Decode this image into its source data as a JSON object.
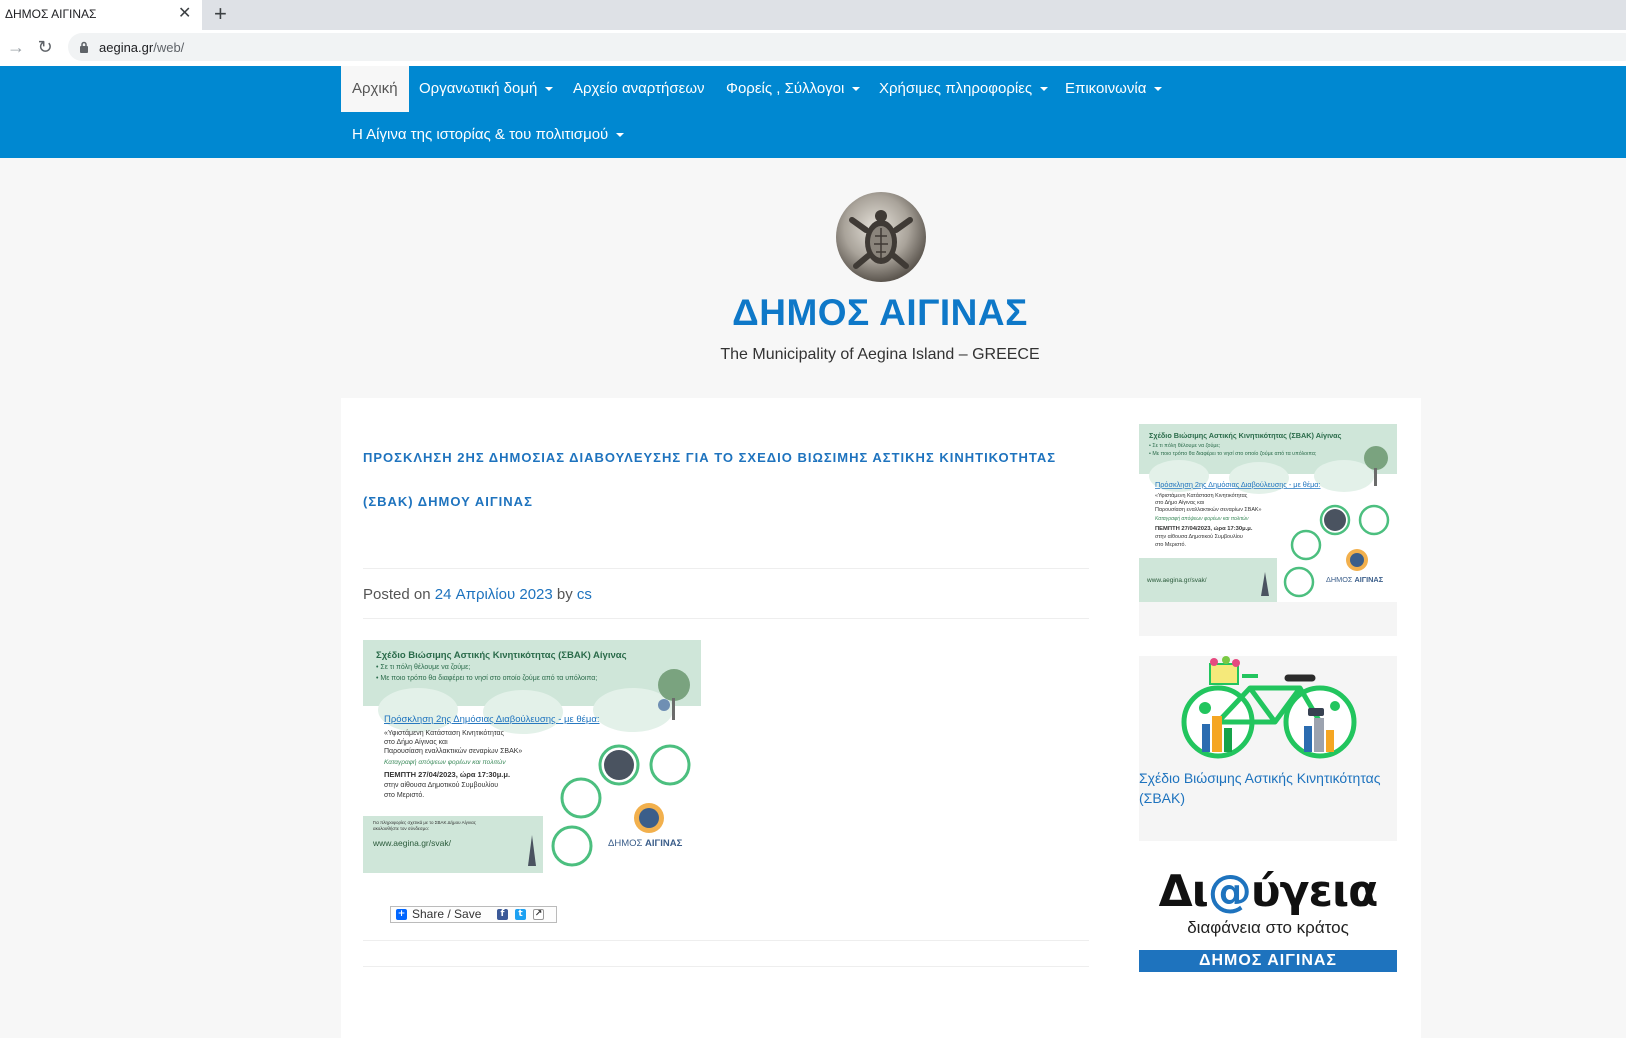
{
  "browser": {
    "tab_title": "ΔΗΜΟΣ ΑΙΓΙΝΑΣ",
    "tab_close": "✕",
    "new_tab": "+",
    "url_domain": "aegina.gr",
    "url_path": "/web/"
  },
  "nav": {
    "items": [
      {
        "label": "Αρχική",
        "active": true,
        "dropdown": false
      },
      {
        "label": "Οργανωτική δομή",
        "dropdown": true
      },
      {
        "label": "Αρχείο αναρτήσεων",
        "dropdown": false
      },
      {
        "label": "Φορείς , Σύλλογοι",
        "dropdown": true
      },
      {
        "label": "Χρήσιμες πληροφορίες",
        "dropdown": true
      },
      {
        "label": "Επικοινωνία",
        "dropdown": true
      },
      {
        "label": "Η Αίγινα της ιστορίας & του πολιτισμού",
        "dropdown": true
      }
    ]
  },
  "header": {
    "site_title": "ΔΗΜΟΣ ΑΙΓΙΝΑΣ",
    "tagline": "The Municipality of Aegina Island – GREECE"
  },
  "post": {
    "title": "ΠΡΟΣΚΛΗΣΗ 2ης ΔΗΜΟΣΙΑΣ ΔΙΑΒΟΥΛΕΥΣΗΣ ΓΙΑ ΤΟ ΣΧΕΔΙΟ ΒΙΩΣΙΜΗΣ ΑΣΤΙΚΗΣ ΚΙΝΗΤΙΚΟΤΗΤΑΣ (ΣΒΑΚ) ΔΗΜΟΥ ΑΙΓΙΝΑΣ",
    "posted_on": "Posted on",
    "date": "24 Απριλίου 2023",
    "by": "by",
    "author": "cs",
    "share_label": "Share / Save"
  },
  "poster": {
    "heading": "Σχέδιο Βιώσιμης Αστικής Κινητικότητας (ΣΒΑΚ) Αίγινας",
    "bullet1": "• Σε τι πόλη θέλουμε να ζούμε;",
    "bullet2": "• Με ποιο τρόπο θα διαφέρει το νησί στο οποίο ζούμε από τα υπόλοιπα;",
    "invite": "Πρόσκληση 2ης Δημόσιας Διαβούλευσης - με θέμα:",
    "line1": "«Υφιστάμενη Κατάσταση Κινητικότητας",
    "line2": "στο Δήμο Αίγινας και",
    "line3": "Παρουσίαση εναλλακτικών σεναρίων ΣΒΑΚ»",
    "line4": "Καταγραφή απόψεων φορέων και πολιτών",
    "line5": "ΠΕΜΠΤΗ 27/04/2023, ώρα 17:30μ.μ.",
    "line6": "στην αίθουσα Δημοτικού Συμβουλίου",
    "line7": "στο Μεριστό.",
    "info": "Για πληροφορίες σχετικά με το ΣΒΑΚ Δήμου Αίγινας",
    "info2": "ακολουθήστε τον σύνδεσμο:",
    "link": "www.aegina.gr/svak/",
    "brand_a": "ΔΗΜΟΣ",
    "brand_b": "ΑΙΓΙΝΑΣ"
  },
  "sidebar": {
    "bike_link": "Σχέδιο Βιώσιμης Αστικής Κινητικότητας (ΣΒΑΚ)",
    "diavgeia_a": "Δι",
    "diavgeia_at": "@",
    "diavgeia_b": "ύγεια",
    "diavgeia_sub": "διαφάνεια στο κράτος",
    "diavgeia_band": "ΔΗΜΟΣ   ΑΙΓΙΝΑΣ"
  },
  "colors": {
    "nav_blue": "#0088d1",
    "title_blue": "#0e78c8",
    "link_blue": "#1e73be",
    "poster_green": "#cfe6d9"
  }
}
